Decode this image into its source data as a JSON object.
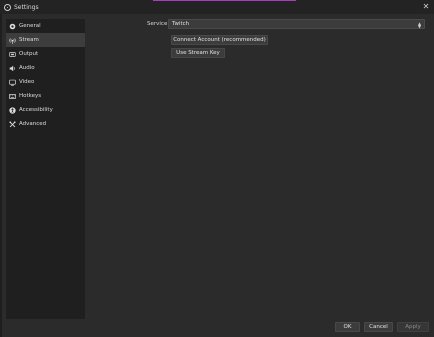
{
  "window": {
    "title": "Settings"
  },
  "sidebar": {
    "items": [
      {
        "label": "General",
        "icon": "gear-icon"
      },
      {
        "label": "Stream",
        "icon": "antenna-icon"
      },
      {
        "label": "Output",
        "icon": "output-icon"
      },
      {
        "label": "Audio",
        "icon": "speaker-icon"
      },
      {
        "label": "Video",
        "icon": "monitor-icon"
      },
      {
        "label": "Hotkeys",
        "icon": "keyboard-icon"
      },
      {
        "label": "Accessibility",
        "icon": "accessibility-icon"
      },
      {
        "label": "Advanced",
        "icon": "wrench-icon"
      }
    ],
    "active": "Stream"
  },
  "stream": {
    "service_label": "Service",
    "service_value": "Twitch",
    "connect_label": "Connect Account (recommended)",
    "stream_key_label": "Use Stream Key"
  },
  "footer": {
    "ok_label": "OK",
    "cancel_label": "Cancel",
    "apply_label": "Apply"
  },
  "colors": {
    "background": "#2b2b2b",
    "sidebar": "#1f1f1f",
    "active_item": "#3d3d3d",
    "accent": "#a63fbf"
  }
}
